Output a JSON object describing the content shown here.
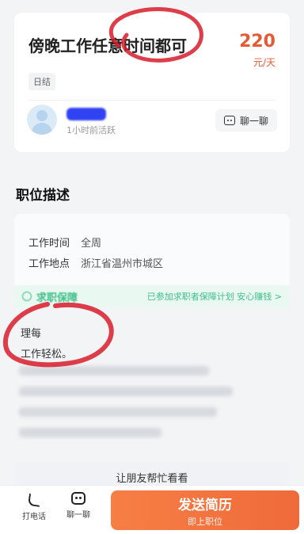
{
  "job": {
    "title": "傍晚工作任意时间都可",
    "salary": "220",
    "salary_unit": "元/天",
    "tag": "日结"
  },
  "recruiter": {
    "active": "1小时前活跃",
    "chat_label": "聊一聊"
  },
  "description": {
    "section_title": "职位描述",
    "work_time_label": "工作时间",
    "work_time": "全周",
    "work_place_label": "工作地点",
    "work_place": "浙江省温州市城区",
    "guarantee_title": "求职保障",
    "guarantee_text": "已参加求职者保障计划 安心赚钱 >",
    "line1": "理每",
    "line2": "工作轻松。"
  },
  "share": {
    "label": "让朋友帮忙看看"
  },
  "bottom": {
    "call_label": "打电话",
    "chat_label": "聊一聊",
    "send_label": "发送简历",
    "send_sub": "即上职位"
  },
  "colors": {
    "accent": "#ef6a3a",
    "salary": "#e55a34",
    "guarantee": "#3fbf8a",
    "scribble": "#d81b2a"
  }
}
